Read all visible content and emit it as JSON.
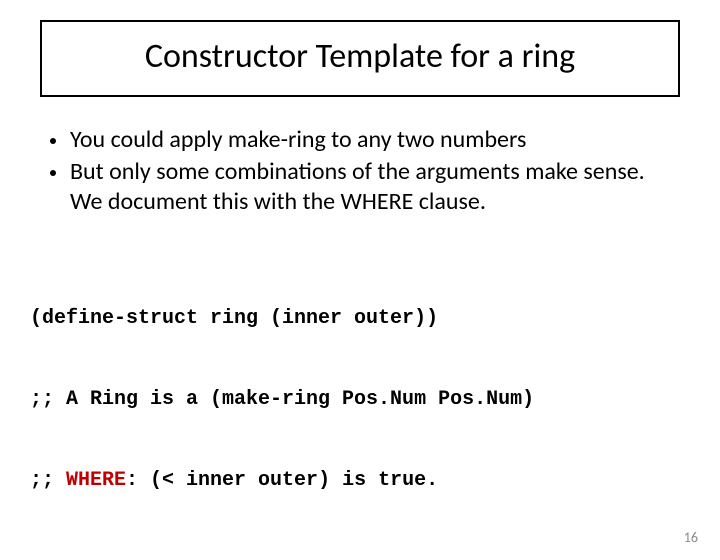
{
  "title": "Constructor Template for a ring",
  "bullets": [
    "You could apply make-ring to any two numbers",
    "But only some combinations of the arguments make sense.  We document this with the WHERE clause."
  ],
  "code": {
    "line1": "(define-struct ring (inner outer))",
    "line2": ";; A Ring is a (make-ring Pos.Num Pos.Num)",
    "line3_prefix": ";; ",
    "line3_where": "WHERE",
    "line3_rest": ": (< inner outer) is true."
  },
  "pageNumber": "16"
}
